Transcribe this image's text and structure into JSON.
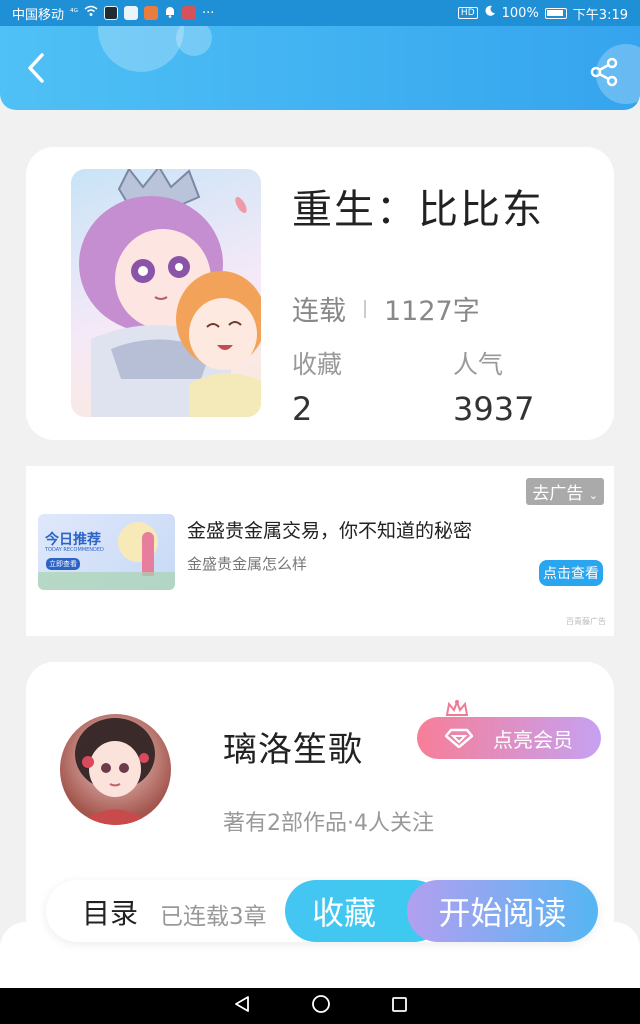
{
  "status_bar": {
    "carrier": "中国移动",
    "signal_text": "⁴ᴳ",
    "hd": "HD",
    "battery": "100%",
    "time": "下午3:19",
    "more": "···"
  },
  "header": {
    "back_icon": "chevron-left-icon",
    "share_icon": "share-icon"
  },
  "book": {
    "title": "重生：比比东",
    "status": "连载",
    "word_count": "1127字",
    "favorites_label": "收藏",
    "favorites_value": "2",
    "popularity_label": "人气",
    "popularity_value": "3937"
  },
  "ad": {
    "close_label": "去广告",
    "image_title": "今日推荐",
    "image_subtitle": "TODAY RECOMMENDED",
    "image_button": "立即查看",
    "title": "金盛贵金属交易，你不知道的秘密",
    "subtitle": "金盛贵金属怎么样",
    "cta": "点击查看",
    "source": "百青藤广告"
  },
  "author": {
    "name": "璃洛笙歌",
    "meta": "著有2部作品·4人关注",
    "vip_label": "点亮会员"
  },
  "actions": {
    "toc_label": "目录",
    "chapter_count": "已连载3章",
    "collect_label": "收藏",
    "read_label": "开始阅读"
  },
  "colors": {
    "header_start": "#4fc1f5",
    "header_end": "#35a4ee",
    "collect_bg": "#45c5f2",
    "read_start": "#b39ff0",
    "vip_start": "#f77e97",
    "vip_end": "#c6a1f2"
  }
}
